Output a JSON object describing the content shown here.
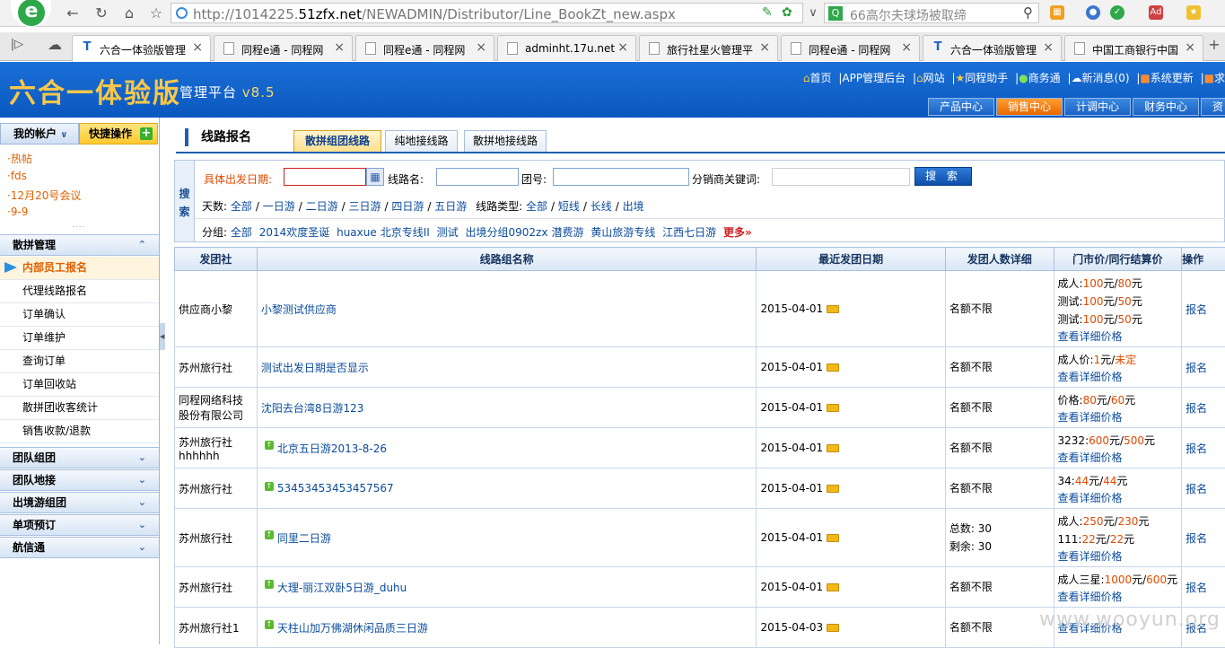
{
  "browser": {
    "url_prefix": "http://1014225.",
    "url_domain": "51zfx.net",
    "url_path": "/NEWADMIN/Distributor/Line_BookZt_new.aspx",
    "search_text": "66高尔夫球场被取缔",
    "tabs": [
      {
        "title": "六合一体验版管理",
        "active": true
      },
      {
        "title": "同程e通 - 同程网"
      },
      {
        "title": "同程e通 - 同程网"
      },
      {
        "title": "adminht.17u.net"
      },
      {
        "title": "旅行社星火管理平"
      },
      {
        "title": "同程e通 - 同程网"
      },
      {
        "title": "六合一体验版管理"
      },
      {
        "title": "中国工商银行中国"
      }
    ],
    "new_tab": "+"
  },
  "app": {
    "title": "六合一体验版",
    "subtitle": "管理平台",
    "version": "v8.5",
    "top_links": [
      "首页",
      "APP管理后台",
      "网站",
      "同程助手",
      "商务通",
      "新消息(0)",
      "系统更新",
      "求"
    ],
    "main_tabs": [
      "产品中心",
      "销售中心",
      "计调中心",
      "财务中心",
      "资"
    ]
  },
  "sidebar": {
    "account_label": "我的帐户",
    "quick_label": "快捷操作",
    "quick_links": [
      "·热帖",
      "·fds",
      "·12月20号会议",
      "·9-9"
    ],
    "grip": "....",
    "section1": "散拼管理",
    "items": [
      "内部员工报名",
      "代理线路报名",
      "订单确认",
      "订单维护",
      "查询订单",
      "订单回收站",
      "散拼团收客统计",
      "销售收款/退款"
    ],
    "sections": [
      "团队组团",
      "团队地接",
      "出境游组团",
      "单项预订",
      "航信通"
    ]
  },
  "main": {
    "page_title": "线路报名",
    "sub_tabs": [
      "散拼组团线路",
      "纯地接线路",
      "散拼地接线路"
    ],
    "search": {
      "side_label": "搜索",
      "date_label": "具体出发日期:",
      "route_label": "线路名:",
      "group_label": "团号:",
      "keyword_label": "分销商关键词:",
      "button": "搜 索",
      "days_label": "天数:",
      "days": [
        "全部",
        "一日游",
        "二日游",
        "三日游",
        "四日游",
        "五日游"
      ],
      "type_label": "线路类型:",
      "types": [
        "全部",
        "短线",
        "长线",
        "出境"
      ],
      "group_cat_label": "分组:",
      "groups": [
        "全部",
        "2014欢度圣诞",
        "huaxue",
        "北京专线II",
        "测试",
        "出境分组0902zx",
        "潜费游",
        "黄山旅游专线",
        "江西七日游"
      ],
      "more": "更多»"
    },
    "table": {
      "headers": [
        "发团社",
        "线路组名称",
        "最近发团日期",
        "发团人数详细",
        "门市价/同行结算价",
        "操作"
      ],
      "rows": [
        {
          "agency": "供应商小黎",
          "name": "小黎测试供应商",
          "up": false,
          "date": "2015-04-01",
          "seats": [
            "名额不限"
          ],
          "prices": [
            [
              "成人:",
              "100",
              "元/",
              "80",
              "元"
            ],
            [
              "测试:",
              "100",
              "元/",
              "50",
              "元"
            ],
            [
              "测试:",
              "100",
              "元/",
              "50",
              "元"
            ]
          ],
          "detail": "查看详细价格",
          "op": "报名"
        },
        {
          "agency": "苏州旅行社",
          "name": "测试出发日期是否显示",
          "up": false,
          "date": "2015-04-01",
          "seats": [
            "名额不限"
          ],
          "prices": [
            [
              "成人价:",
              "1",
              "元/",
              "未定",
              ""
            ]
          ],
          "detail": "查看详细价格",
          "op": "报名"
        },
        {
          "agency": "同程网络科技股份有限公司",
          "name": "沈阳去台湾8日游123",
          "up": false,
          "date": "2015-04-01",
          "seats": [
            "名额不限"
          ],
          "prices": [
            [
              "价格:",
              "80",
              "元/",
              "60",
              "元"
            ]
          ],
          "detail": "查看详细价格",
          "op": "报名"
        },
        {
          "agency": "苏州旅行社 hhhhhh",
          "name": "北京五日游2013-8-26",
          "up": true,
          "date": "2015-04-01",
          "seats": [
            "名额不限"
          ],
          "prices": [
            [
              "3232:",
              "600",
              "元/",
              "500",
              "元"
            ]
          ],
          "detail": "查看详细价格",
          "op": "报名"
        },
        {
          "agency": "苏州旅行社",
          "name": "53453453453457567",
          "up": true,
          "date": "2015-04-01",
          "seats": [
            "名额不限"
          ],
          "prices": [
            [
              "34:",
              "44",
              "元/",
              "44",
              "元"
            ]
          ],
          "detail": "查看详细价格",
          "op": "报名"
        },
        {
          "agency": "苏州旅行社",
          "name": "同里二日游",
          "up": true,
          "date": "2015-04-01",
          "seats": [
            "总数: 30",
            "剩余: 30"
          ],
          "prices": [
            [
              "成人:",
              "250",
              "元/",
              "230",
              "元"
            ],
            [
              "111:",
              "22",
              "元/",
              "22",
              "元"
            ]
          ],
          "detail": "查看详细价格",
          "op": "报名"
        },
        {
          "agency": "苏州旅行社",
          "name": "大理-丽江双卧5日游_duhu",
          "up": true,
          "date": "2015-04-01",
          "seats": [
            "名额不限"
          ],
          "prices": [
            [
              "成人三星:",
              "1000",
              "元/",
              "600",
              "元"
            ]
          ],
          "detail": "查看详细价格",
          "op": "报名"
        },
        {
          "agency": "苏州旅行社1",
          "name": "天柱山加万佛湖休闲品质三日游",
          "up": true,
          "date": "2015-04-03",
          "seats": [
            "名额不限"
          ],
          "prices": [
            [
              "",
              "",
              "",
              "",
              ""
            ]
          ],
          "detail": "查看详细价格",
          "op": "报名"
        }
      ]
    }
  },
  "watermark": "www.wooyun.org"
}
